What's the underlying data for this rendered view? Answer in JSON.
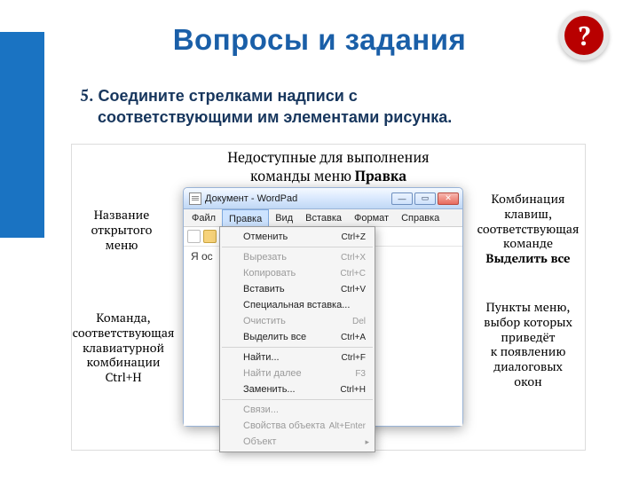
{
  "title": "Вопросы и задания",
  "badge": "?",
  "question": {
    "number": "5.",
    "text_line1": "Соедините стрелками надписи с",
    "text_line2": "соответствующими им элементами рисунка."
  },
  "figure": {
    "caption_line1": "Недоступные для выполнения",
    "caption_line2_prefix": "команды меню ",
    "caption_line2_bold": "Правка",
    "labels": {
      "openMenu": {
        "l1": "Название",
        "l2": "открытого",
        "l3": "меню"
      },
      "ctrlH": {
        "l1": "Команда,",
        "l2": "соответствующая",
        "l3": "клавиатурной",
        "l4": "комбинации",
        "l5": "Ctrl+H"
      },
      "shortcut": {
        "l1": "Комбинация",
        "l2": "клавиш,",
        "l3": "соответствующая",
        "l4": "команде",
        "bold": "Выделить все"
      },
      "dialogs": {
        "l1": "Пункты меню,",
        "l2": "выбор которых",
        "l3": "приведёт",
        "l4": "к появлению",
        "l5": "диалоговых",
        "l6": "окон"
      }
    }
  },
  "app": {
    "title_text": "Документ - WordPad",
    "menubar": [
      "Файл",
      "Правка",
      "Вид",
      "Вставка",
      "Формат",
      "Справка"
    ],
    "doc_text": "Я ос",
    "dropdown": [
      {
        "label": "Отменить",
        "sc": "Ctrl+Z",
        "disabled": false
      },
      {
        "hr": true
      },
      {
        "label": "Вырезать",
        "sc": "Ctrl+X",
        "disabled": true
      },
      {
        "label": "Копировать",
        "sc": "Ctrl+C",
        "disabled": true
      },
      {
        "label": "Вставить",
        "sc": "Ctrl+V",
        "disabled": false
      },
      {
        "label": "Специальная вставка...",
        "sc": "",
        "disabled": false
      },
      {
        "label": "Очистить",
        "sc": "Del",
        "disabled": true
      },
      {
        "label": "Выделить все",
        "sc": "Ctrl+A",
        "disabled": false
      },
      {
        "hr": true
      },
      {
        "label": "Найти...",
        "sc": "Ctrl+F",
        "disabled": false
      },
      {
        "label": "Найти далее",
        "sc": "F3",
        "disabled": true
      },
      {
        "label": "Заменить...",
        "sc": "Ctrl+H",
        "disabled": false
      },
      {
        "hr": true
      },
      {
        "label": "Связи...",
        "sc": "",
        "disabled": true
      },
      {
        "label": "Свойства объекта",
        "sc": "Alt+Enter",
        "disabled": true
      },
      {
        "label": "Объект",
        "sc": "",
        "disabled": true,
        "arrow": true
      }
    ]
  }
}
